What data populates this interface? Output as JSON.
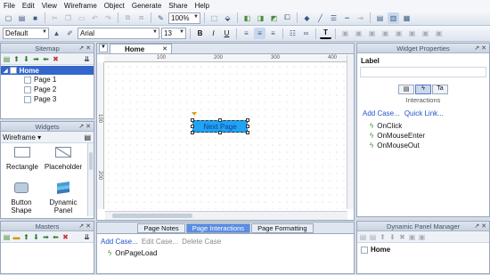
{
  "menu": [
    "File",
    "Edit",
    "View",
    "Wireframe",
    "Object",
    "Generate",
    "Share",
    "Help"
  ],
  "toolbar": {
    "zoom": "100%"
  },
  "format": {
    "style": "Default",
    "font": "Arial",
    "size": "13",
    "bold": "B",
    "italic": "I",
    "underline": "U"
  },
  "sitemap": {
    "title": "Sitemap",
    "home": "Home",
    "pages": [
      "Page 1",
      "Page 2",
      "Page 3"
    ]
  },
  "widgets": {
    "title": "Widgets",
    "library": "Wireframe",
    "items": [
      "Rectangle",
      "Placeholder",
      "Button Shape",
      "Dynamic Panel"
    ]
  },
  "masters": {
    "title": "Masters"
  },
  "canvas": {
    "tab": "Home",
    "ruler": [
      "100",
      "200",
      "300",
      "400"
    ],
    "vruler": [
      "100",
      "200",
      "300"
    ],
    "button_label": "Next Page"
  },
  "bottom": {
    "tabs": [
      "Page Notes",
      "Page Interactions",
      "Page Formatting"
    ],
    "add_case": "Add Case...",
    "edit_case": "Edit Case...",
    "delete_case": "Delete Case",
    "event": "OnPageLoad"
  },
  "props": {
    "title": "Widget Properties",
    "label_heading": "Label",
    "interactions": "Interactions",
    "add_case": "Add Case...",
    "quick_link": "Quick Link...",
    "events": [
      "OnClick",
      "OnMouseEnter",
      "OnMouseOut"
    ]
  },
  "dpm": {
    "title": "Dynamic Panel Manager",
    "item": "Home"
  },
  "colors": {
    "accent": "#3366cc",
    "button": "#1ea3f5"
  }
}
